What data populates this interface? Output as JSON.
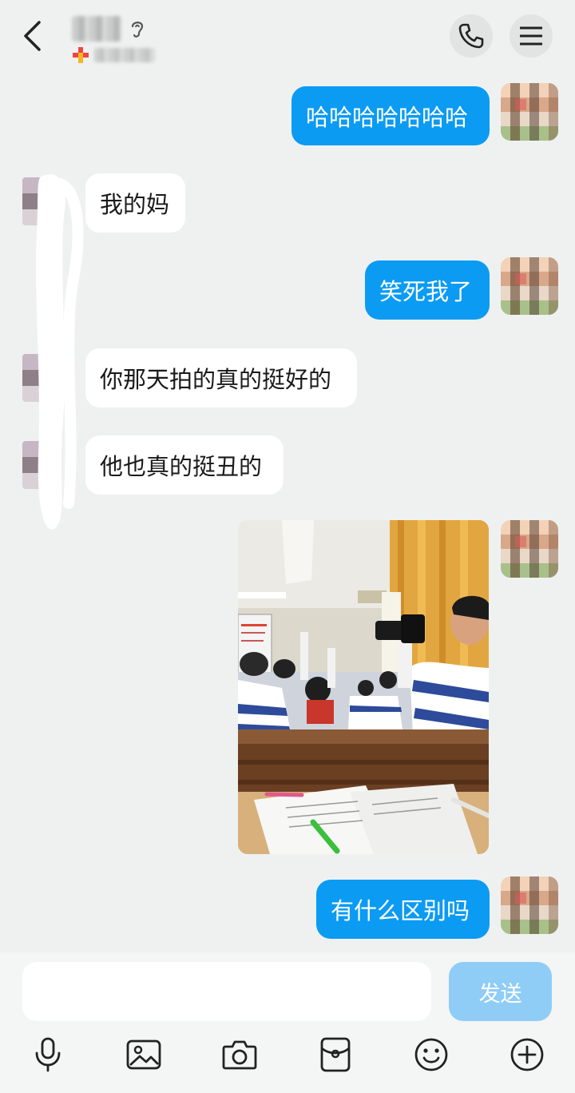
{
  "header": {
    "back_icon": "chevron-left-icon",
    "call_icon": "phone-icon",
    "menu_icon": "hamburger-menu-icon"
  },
  "messages": [
    {
      "side": "me",
      "text": "哈哈哈哈哈哈哈"
    },
    {
      "side": "them",
      "text": "我的妈"
    },
    {
      "side": "me",
      "text": "笑死我了"
    },
    {
      "side": "them",
      "text": "你那天拍的真的挺好的"
    },
    {
      "side": "them",
      "text": "他也真的挺丑的"
    },
    {
      "side": "me",
      "type": "image"
    },
    {
      "side": "me",
      "text": "有什么区别吗"
    }
  ],
  "composer": {
    "input_value": "",
    "send_label": "发送"
  },
  "toolbar": [
    "microphone-icon",
    "image-icon",
    "camera-icon",
    "red-packet-icon",
    "emoji-icon",
    "plus-icon"
  ],
  "colors": {
    "background": "#eef1f0",
    "outgoing_bubble": "#0b9bf3",
    "incoming_bubble": "#ffffff",
    "send_button_disabled": "#8fcdf7"
  }
}
